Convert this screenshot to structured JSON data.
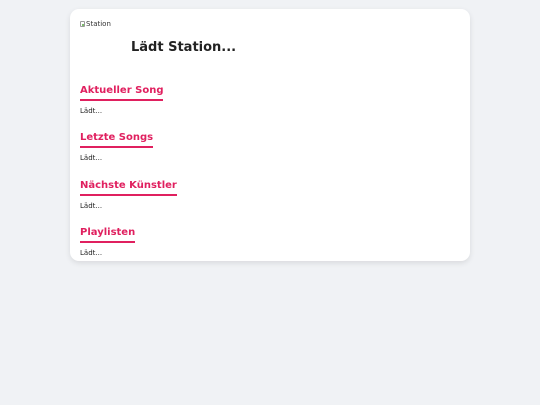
{
  "header": {
    "logo_alt": "Station",
    "logo_icon": "broken-image-icon",
    "title": "Lädt Station..."
  },
  "sections": [
    {
      "title": "Aktueller Song",
      "status": "Lädt..."
    },
    {
      "title": "Letzte Songs",
      "status": "Lädt..."
    },
    {
      "title": "Nächste Künstler",
      "status": "Lädt..."
    },
    {
      "title": "Playlisten",
      "status": "Lädt..."
    }
  ],
  "colors": {
    "accent": "#e0205f",
    "background": "#f0f2f5",
    "card": "#ffffff",
    "text": "#222222"
  }
}
